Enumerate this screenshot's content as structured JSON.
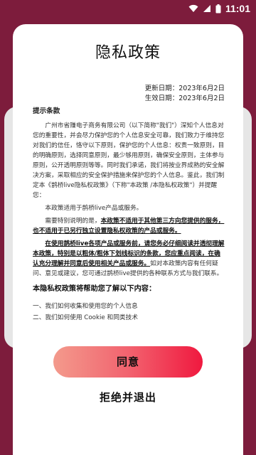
{
  "status_bar": {
    "time": "11:01"
  },
  "dialog": {
    "title": "隐私政策",
    "updated_date": "更新日期：2023年6月2日",
    "effective_date": "生效日期：2023年6月2日",
    "section_title": "提示条款",
    "para1": "广州市省赚电子商务有限公司（以下简称\"我们\"）深知个人信息对您的重要性，并会尽力保护您的个人信息安全可靠，我们致力于维持您对我们的信任，恪守以下原则，保护您的个人信息：权责一致原则，目的明确原则，选择同意原则，最少够用原则，确保安全原则，主体参与原则，公开透明原则等等。同时我们承诺，我们将按业界成熟的安全解决方案，采取相应的安全保护措施来保护您的个人信息。鉴此，我们制定本《鹊桥live隐私权政策》（下称\"本政策 /本隐私权政策\"）并提醒您：",
    "para2": "本政策适用于鹊桥live产品或服务。",
    "para3_lead": "需要特别说明的是，",
    "para3_bold": "本政策不适用于其他第三方向您提供的服务，也不适用于已另行独立设置隐私权政策的产品或服务。",
    "para4_bold": "在使用鹊桥live各项产品或服务前，请您务必仔细阅读并透彻理解本政策，特别是以粗体/粗体下划线标识的条款，您应重点阅读，在确认充分理解并同意后使用相关产品或服务。",
    "para4_rest": "如对本政策内容有任何疑问、意见或建议，您可通过鹊桥live提供的各种联系方式与我们联系。",
    "help_title": "本隐私权政策将帮助您了解以下内容：",
    "list": [
      "一、我们如何收集和使用您的个人信息",
      "二、我们如何使用 Cookie 和同类技术"
    ],
    "agree_label": "同意",
    "refuse_label": "拒绝并退出"
  }
}
